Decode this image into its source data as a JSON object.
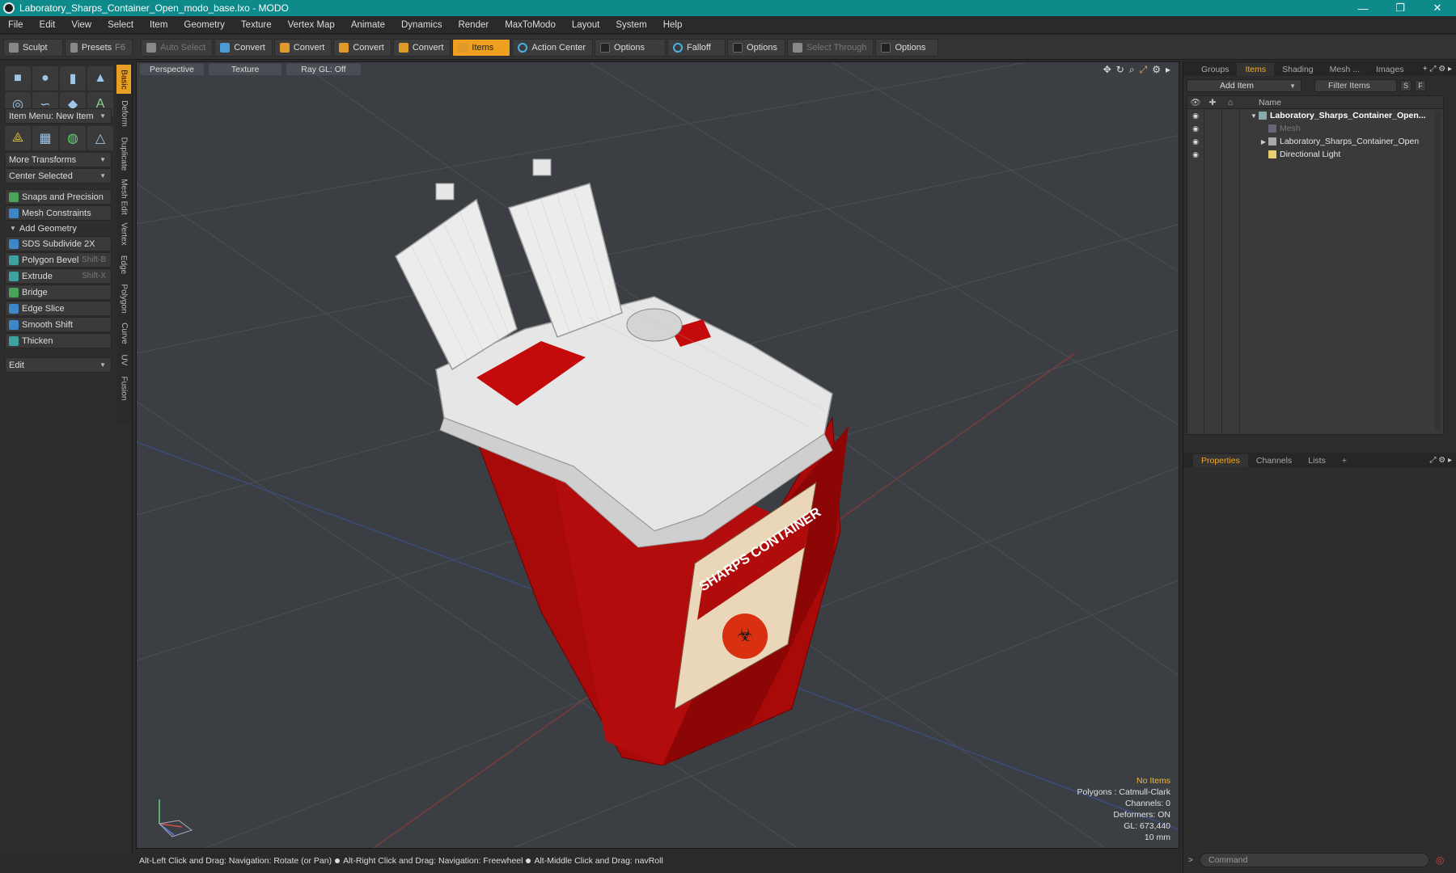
{
  "window": {
    "title": "Laboratory_Sharps_Container_Open_modo_base.lxo - MODO",
    "minimize": "—",
    "maximize": "❐",
    "close": "✕"
  },
  "menu": [
    "File",
    "Edit",
    "View",
    "Select",
    "Item",
    "Geometry",
    "Texture",
    "Vertex Map",
    "Animate",
    "Dynamics",
    "Render",
    "MaxToModo",
    "Layout",
    "System",
    "Help"
  ],
  "toolbar": {
    "sculpt": "Sculpt",
    "presets": "Presets",
    "presets_key": "F6",
    "auto_select": "Auto Select",
    "convert1": "Convert",
    "convert2": "Convert",
    "convert3": "Convert",
    "convert4": "Convert",
    "items": "Items",
    "action_center": "Action Center",
    "options1": "Options",
    "falloff": "Falloff",
    "options2": "Options",
    "select_through": "Select Through",
    "options3": "Options"
  },
  "left_panel": {
    "item_menu": "Item Menu: New Item",
    "more_transforms": "More Transforms",
    "center_selected": "Center Selected",
    "snaps": "Snaps and Precision",
    "mesh_constraints": "Mesh Constraints",
    "add_geometry": "Add Geometry",
    "tools": [
      {
        "label": "SDS Subdivide 2X",
        "key": ""
      },
      {
        "label": "Polygon Bevel",
        "key": "Shift-B"
      },
      {
        "label": "Extrude",
        "key": "Shift-X"
      },
      {
        "label": "Bridge",
        "key": ""
      },
      {
        "label": "Edge Slice",
        "key": ""
      },
      {
        "label": "Smooth Shift",
        "key": ""
      },
      {
        "label": "Thicken",
        "key": ""
      }
    ],
    "edit": "Edit",
    "vtabs": [
      "Basic",
      "Deform",
      "Duplicate",
      "Mesh Edit",
      "Vertex",
      "Edge",
      "Polygon",
      "Curve",
      "UV",
      "Fusion"
    ]
  },
  "viewport": {
    "view": "Perspective",
    "shading": "Texture",
    "raygl": "Ray GL: Off",
    "info": {
      "selection": "No Items",
      "polygons": "Polygons : Catmull-Clark",
      "channels": "Channels: 0",
      "deformers": "Deformers: ON",
      "gl": "GL: 673,440",
      "scale": "10 mm"
    },
    "label_sharps": "SHARPS CONTAINER"
  },
  "status": {
    "hint1": "Alt-Left Click and Drag: Navigation: Rotate (or Pan)",
    "hint2": "Alt-Right Click and Drag: Navigation: Freewheel",
    "hint3": "Alt-Middle Click and Drag: navRoll"
  },
  "items_panel": {
    "tabs": [
      "Groups",
      "Items",
      "Shading",
      "Mesh ...",
      "Images"
    ],
    "add_item": "Add Item",
    "filter": "Filter Items",
    "s_btn": "S",
    "f_btn": "F",
    "col_name": "Name",
    "rows": [
      {
        "label": "Laboratory_Sharps_Container_Open..."
      },
      {
        "label": "Mesh"
      },
      {
        "label": "Laboratory_Sharps_Container_Open"
      },
      {
        "label": "Directional Light"
      }
    ]
  },
  "props_panel": {
    "tabs": [
      "Properties",
      "Channels",
      "Lists"
    ],
    "add": "+"
  },
  "command": {
    "placeholder": "Command"
  }
}
